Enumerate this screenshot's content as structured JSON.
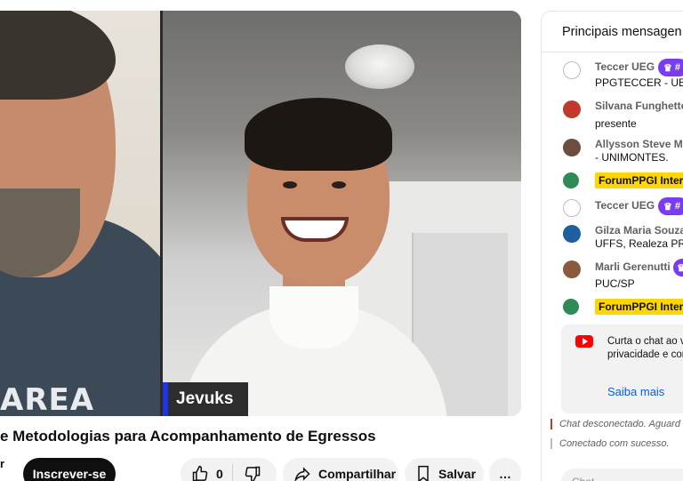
{
  "video": {
    "name_tag": "Jevuks",
    "shirt_text": "AREA"
  },
  "title": "e Metodologias para Acompanhamento de Egressos",
  "channel_fragment": "r",
  "actions": {
    "subscribe": "Inscrever-se",
    "like_count": "0",
    "share": "Compartilhar",
    "save": "Salvar",
    "more": "…"
  },
  "chat": {
    "header": "Principais mensagen",
    "messages": [
      {
        "author": "Teccer UEG",
        "badge": "#",
        "text": "PPGTECCER - UEG",
        "avatar_color": "#ffffff"
      },
      {
        "author": "Silvana Funghetto",
        "text": "presente",
        "avatar_color": "#c0392b"
      },
      {
        "author": "Allysson Steve Mo",
        "text": "- UNIMONTES.",
        "avatar_color": "#6b4e3d"
      },
      {
        "highlight": "ForumPPGI Interd",
        "avatar_color": "#2e8b57"
      },
      {
        "author": "Teccer UEG",
        "badge": "#",
        "avatar_color": "#ffffff"
      },
      {
        "author": "Gilza Maria Souza",
        "text": "UFFS, Realeza PR",
        "avatar_color": "#1f5fa0"
      },
      {
        "author": "Marli Gerenutti",
        "text": "PUC/SP",
        "avatar_color": "#8a5a3c"
      },
      {
        "highlight": "ForumPPGI Interd",
        "avatar_color": "#2e8b57"
      }
    ],
    "notice": {
      "text": "Curta o chat ao v sua privacidade e comunidade.",
      "link": "Saiba mais"
    },
    "status_disconnected": "Chat desconectado. Aguard",
    "status_connected": "Conectado com sucesso.",
    "input_placeholder": "Chat..."
  }
}
